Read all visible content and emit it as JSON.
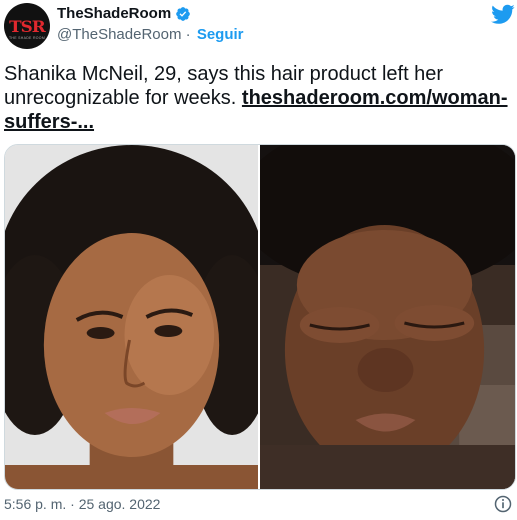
{
  "account": {
    "display_name": "TheShadeRoom",
    "handle": "@TheShadeRoom",
    "separator": " · ",
    "follow_label": "Seguir",
    "avatar_logo": "TSR",
    "avatar_sub": "THE SHADE ROOM"
  },
  "tweet": {
    "text": "Shanika McNeil, 29, says this hair product left her unrecognizable for weeks. ",
    "link_text": "theshaderoom.com/woman-suffers-...",
    "timestamp": "5:56 p. m. · 25 ago. 2022"
  },
  "media": {
    "left_photo_alt": "Woman with curly hair and makeup",
    "right_photo_alt": "Woman with swollen face"
  },
  "icons": {
    "twitter": "twitter-bird-icon",
    "verified": "verified-badge-icon",
    "info": "info-icon"
  },
  "colors": {
    "accent": "#1d9bf0",
    "text": "#0f1419",
    "muted": "#536471"
  }
}
